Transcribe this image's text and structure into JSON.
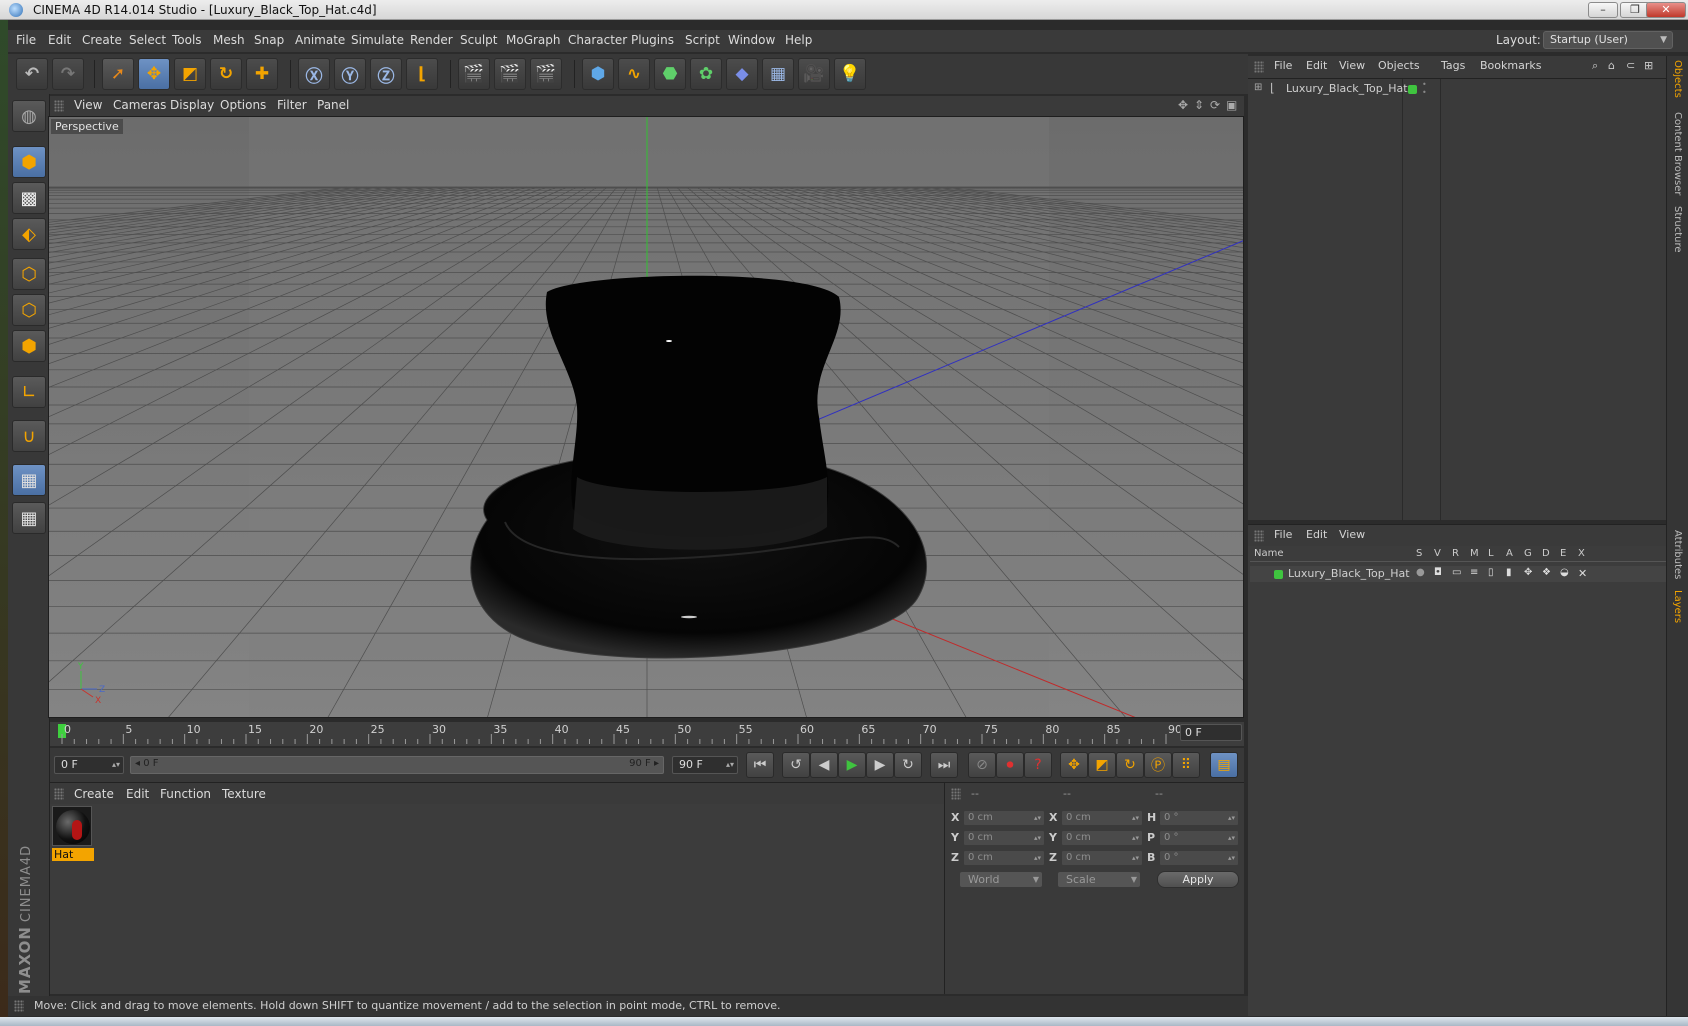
{
  "window": {
    "title": "CINEMA 4D R14.014 Studio - [Luxury_Black_Top_Hat.c4d]",
    "buttons": [
      "–",
      "❐",
      "✕"
    ]
  },
  "menubar": {
    "items": [
      "File",
      "Edit",
      "Create",
      "Select",
      "Tools",
      "Mesh",
      "Snap",
      "Animate",
      "Simulate",
      "Render",
      "Sculpt",
      "MoGraph",
      "Character",
      "Plugins",
      "Script",
      "Window",
      "Help"
    ],
    "layout_label": "Layout:",
    "layout_value": "Startup (User)"
  },
  "viewport": {
    "menu": [
      "View",
      "Cameras",
      "Display",
      "Options",
      "Filter",
      "Panel"
    ],
    "label": "Perspective",
    "axis_labels": {
      "y": "Y",
      "z": "Z",
      "x": "X"
    }
  },
  "timeline": {
    "ticks": [
      "0",
      "5",
      "10",
      "15",
      "20",
      "25",
      "30",
      "35",
      "40",
      "45",
      "50",
      "55",
      "60",
      "65",
      "70",
      "75",
      "80",
      "85",
      "90"
    ],
    "current_frame": "0 F"
  },
  "playback": {
    "start_field": "0 F",
    "range_start": "0 F",
    "range_end": "90 F",
    "end_field": "90 F"
  },
  "material_manager": {
    "menu": [
      "Create",
      "Edit",
      "Function",
      "Texture"
    ],
    "materials": [
      {
        "name": "Hat"
      }
    ]
  },
  "coordinates": {
    "headers": [
      "--",
      "--",
      "--"
    ],
    "rows": [
      {
        "l1": "X",
        "v1": "0 cm",
        "l2": "X",
        "v2": "0 cm",
        "l3": "H",
        "v3": "0 °"
      },
      {
        "l1": "Y",
        "v1": "0 cm",
        "l2": "Y",
        "v2": "0 cm",
        "l3": "P",
        "v3": "0 °"
      },
      {
        "l1": "Z",
        "v1": "0 cm",
        "l2": "Z",
        "v2": "0 cm",
        "l3": "B",
        "v3": "0 °"
      }
    ],
    "mode_select": "World",
    "size_select": "Scale",
    "apply_label": "Apply"
  },
  "status": {
    "text": "Move: Click and drag to move elements. Hold down SHIFT to quantize movement / add to the selection in point mode, CTRL to remove."
  },
  "object_manager": {
    "menu": [
      "File",
      "Edit",
      "View",
      "Objects",
      "Tags",
      "Bookmarks"
    ],
    "objects": [
      {
        "name": "Luxury_Black_Top_Hat"
      }
    ]
  },
  "layer_manager": {
    "menu": [
      "File",
      "Edit",
      "View"
    ],
    "columns": [
      "Name",
      "S",
      "V",
      "R",
      "M",
      "L",
      "A",
      "G",
      "D",
      "E",
      "X"
    ],
    "layers": [
      {
        "name": "Luxury_Black_Top_Hat"
      }
    ]
  },
  "side_tabs": [
    "Objects",
    "Content Browser",
    "Structure",
    "Attributes",
    "Layers"
  ],
  "logo": {
    "brand": "MAXON",
    "product": "CINEMA4D"
  },
  "colors": {
    "accent_orange": "#f3a400",
    "active_blue": "#4a6fa3",
    "layer_green": "#3fc43f",
    "timeline_marker": "#3ecf3e"
  }
}
